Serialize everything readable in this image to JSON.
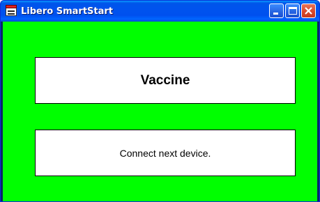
{
  "window": {
    "title": "Libero SmartStart",
    "icon": "app-icon",
    "controls": [
      "minimize-icon",
      "maximize-icon",
      "close-icon"
    ]
  },
  "main": {
    "product_label": "Vaccine",
    "status_message": "Connect next device."
  },
  "colors": {
    "client_background": "#00ff00",
    "panel_background": "#ffffff",
    "titlebar": "#0055ea",
    "close_button": "#d9492c"
  }
}
